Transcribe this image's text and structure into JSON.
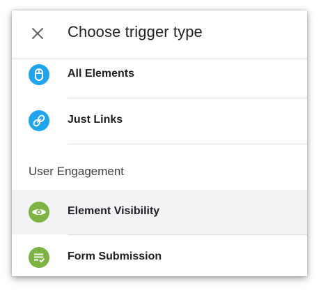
{
  "dialog": {
    "title": "Choose trigger type",
    "close_icon": "close-icon"
  },
  "colors": {
    "blue_icon_bg": "#1ea5f0",
    "green_icon_bg": "#7cb342",
    "selected_row_bg": "#f1f3f4"
  },
  "items": [
    {
      "label": "All Elements",
      "icon": "mouse-icon"
    },
    {
      "label": "Just Links",
      "icon": "link-icon"
    }
  ],
  "section": {
    "label": "User Engagement",
    "items": [
      {
        "label": "Element Visibility",
        "icon": "eye-icon",
        "selected": true
      },
      {
        "label": "Form Submission",
        "icon": "form-check-icon"
      }
    ]
  }
}
